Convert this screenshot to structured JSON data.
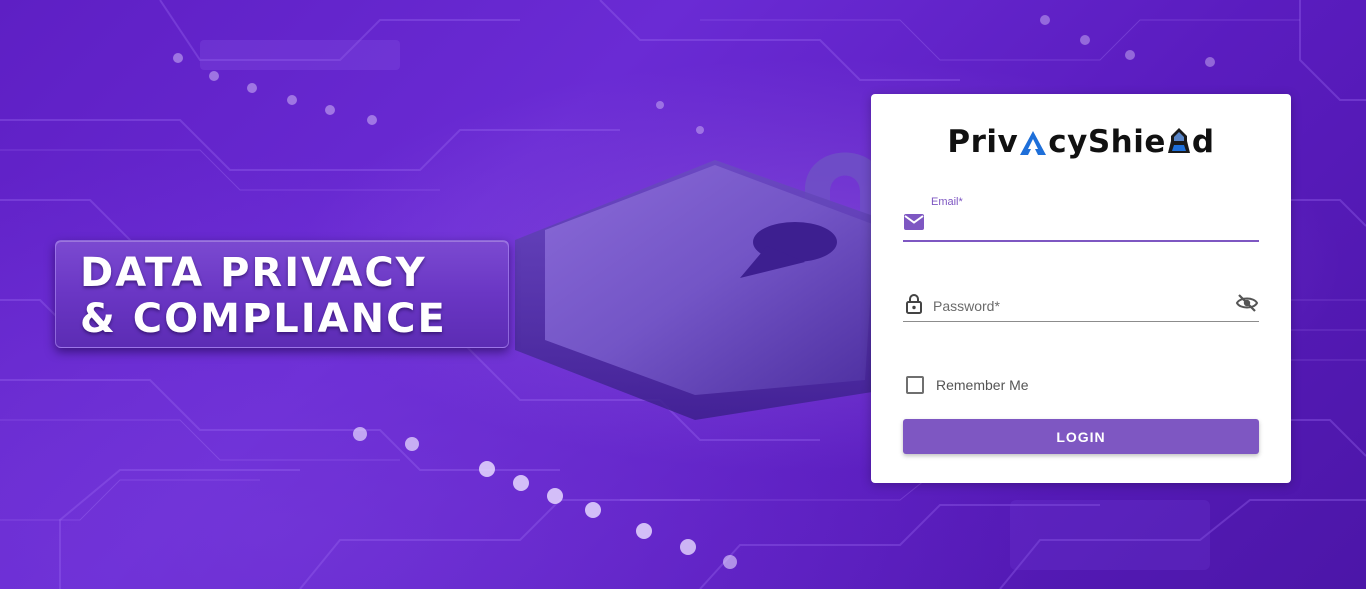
{
  "banner": {
    "line1": "DATA PRIVACY",
    "line2": "& COMPLIANCE"
  },
  "logo": {
    "part1": "Priv",
    "part2": "cyShie",
    "part3": "d"
  },
  "form": {
    "email_label": "Email*",
    "email_value": "",
    "password_placeholder": "Password*",
    "remember_label": "Remember Me",
    "remember_checked": false,
    "login_label": "LOGIN"
  },
  "icons": {
    "email": "mail-icon",
    "password": "lock-icon",
    "visibility": "eye-off-icon",
    "background": "padlock-illustration"
  },
  "colors": {
    "accent": "#7e57c2",
    "background": "#5e1fc4",
    "card": "#ffffff"
  }
}
